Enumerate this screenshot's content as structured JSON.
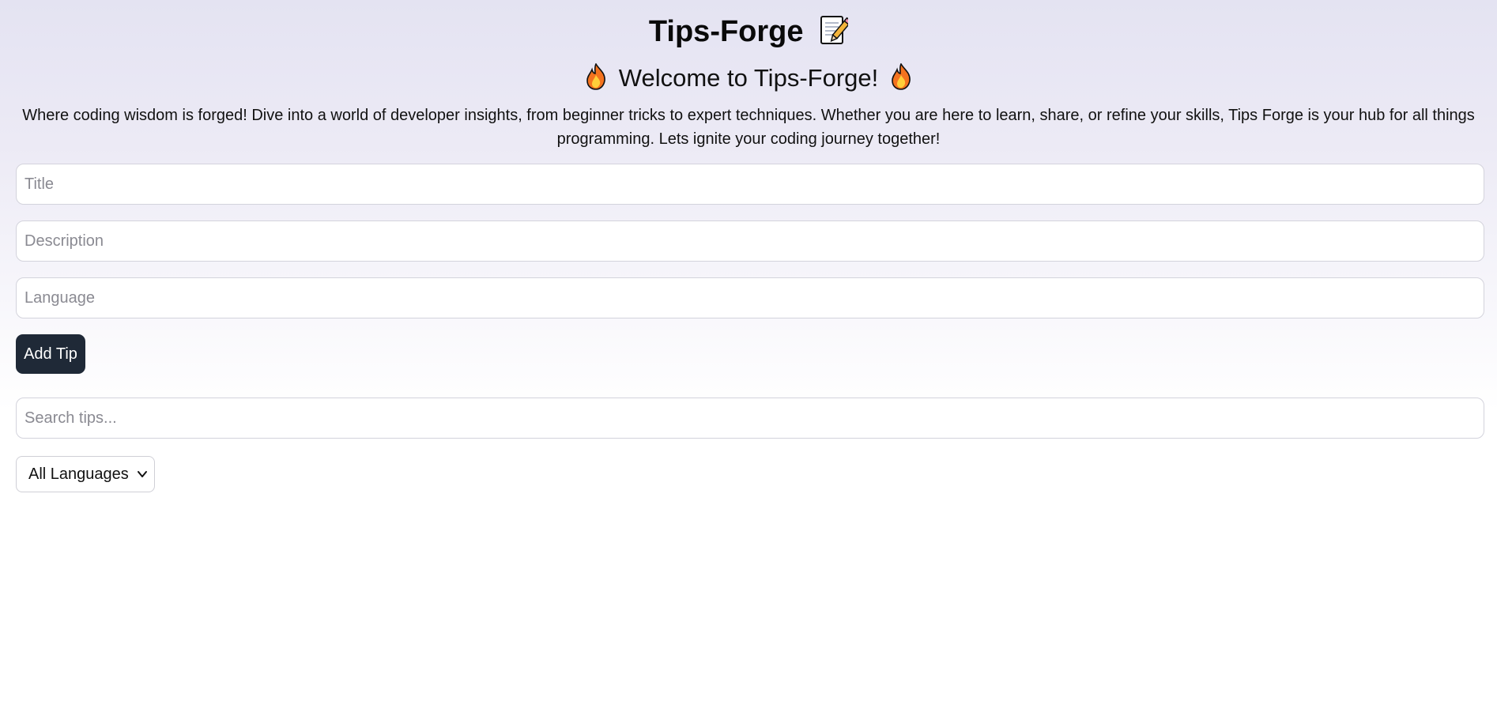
{
  "header": {
    "title": "Tips-Forge",
    "title_icon": "memo-icon",
    "welcome": "Welcome to Tips-Forge!",
    "welcome_icons": [
      "fire-icon",
      "fire-icon"
    ],
    "intro": "Where coding wisdom is forged! Dive into a world of developer insights, from beginner tricks to expert techniques. Whether you are here to learn, share, or refine your skills, Tips Forge is your hub for all things programming. Lets ignite your coding journey together!"
  },
  "form": {
    "title_placeholder": "Title",
    "title_value": "",
    "description_placeholder": "Description",
    "description_value": "",
    "language_placeholder": "Language",
    "language_value": "",
    "add_button_label": "Add Tip"
  },
  "filters": {
    "search_placeholder": "Search tips...",
    "search_value": "",
    "language_selected": "All Languages"
  },
  "colors": {
    "button_bg": "#1f2937",
    "button_text": "#ffffff",
    "background_tint": "#e4e3f2",
    "input_border": "#d3d3dc",
    "placeholder": "#8a8a92"
  }
}
